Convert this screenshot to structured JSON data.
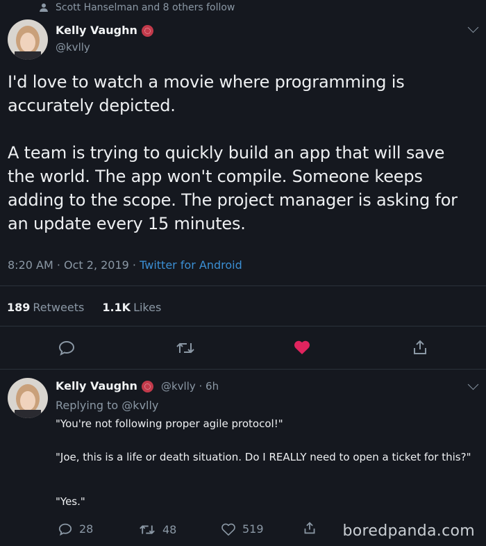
{
  "social_context": "Scott Hanselman and 8 others follow",
  "tweet": {
    "name": "Kelly Vaughn",
    "handle": "@kvlly",
    "text": "I'd love to watch a movie where programming is\naccurately depicted.\n\nA team is trying to quickly build an app that will save\nthe world. The app won't compile. Someone keeps\nadding to the scope. The project manager is asking for\nan update every 15 minutes.",
    "time": "8:20 AM · Oct 2, 2019 · ",
    "client": "Twitter for Android",
    "retweets_count": "189",
    "retweets_label": "Retweets",
    "likes_count": "1.1K",
    "likes_label": "Likes",
    "liked": true,
    "colors": {
      "heart": "#e0245e",
      "link": "#3b8fd4",
      "background": "#15181f"
    }
  },
  "reply": {
    "name": "Kelly Vaughn",
    "handle_time": "@kvlly · 6h",
    "replying_prefix": "Replying to ",
    "replying_to": "@kvlly",
    "line1": "\"You're not following proper agile protocol!\"",
    "line2": "\"Joe, this is a life or death situation. Do I REALLY need to open a ticket for this?\"",
    "line3": "\"Yes.\"",
    "reply_count": "28",
    "retweet_count": "48",
    "like_count": "519"
  },
  "icons": [
    "person-icon",
    "verified-badge-icon",
    "chevron-down-icon",
    "reply-icon",
    "retweet-icon",
    "heart-icon",
    "share-icon"
  ],
  "watermark": "boredpanda.com"
}
